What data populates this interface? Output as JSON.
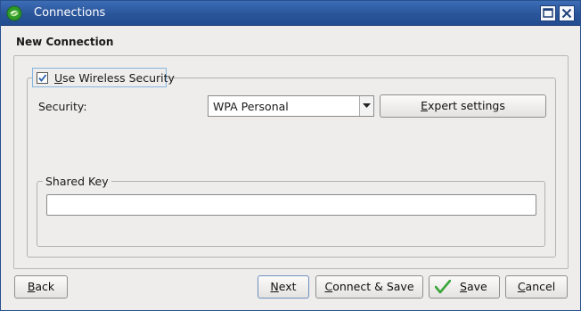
{
  "window": {
    "title": "Connections",
    "icons": {
      "app": "green-swirl-icon",
      "maximize": "maximize-icon",
      "close": "close-icon"
    },
    "colors": {
      "titlebar": "#2a559a",
      "background": "#eeedeb",
      "accent_check": "#3aa53a"
    }
  },
  "page": {
    "heading": "New Connection"
  },
  "security_group": {
    "checkbox_label_first": "U",
    "checkbox_label_rest": "se Wireless Security",
    "checked": true,
    "security_label": "Security:",
    "security_value": "WPA Personal",
    "expert_label_first": "E",
    "expert_label_rest": "xpert settings"
  },
  "shared_key": {
    "legend": "Shared Key",
    "value": ""
  },
  "buttons": {
    "back_first": "B",
    "back_rest": "ack",
    "next_first": "N",
    "next_rest": "ext",
    "connect_first": "C",
    "connect_rest": "onnect & Save",
    "save_first": "S",
    "save_rest": "ave",
    "cancel_first": "C",
    "cancel_rest": "ancel"
  }
}
